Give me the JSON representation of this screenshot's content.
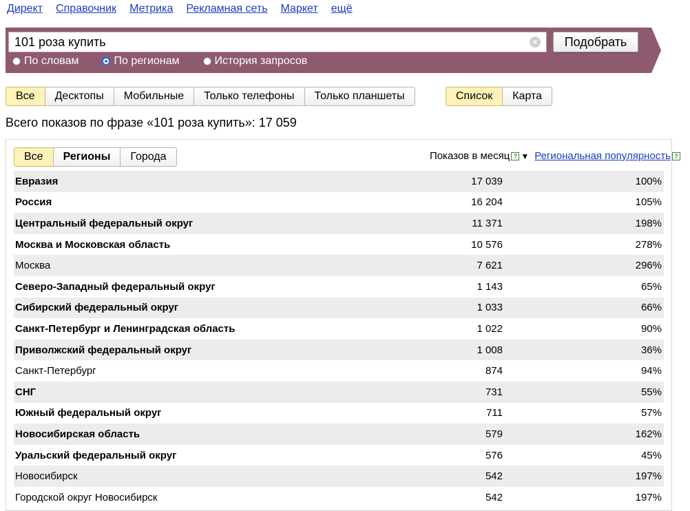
{
  "topnav": [
    "Директ",
    "Справочник",
    "Метрика",
    "Рекламная сеть",
    "Маркет",
    "ещё"
  ],
  "search": {
    "value": "101 роза купить",
    "button": "Подобрать"
  },
  "modes": [
    {
      "label": "По словам",
      "selected": false
    },
    {
      "label": "По регионам",
      "selected": true
    },
    {
      "label": "История запросов",
      "selected": false
    }
  ],
  "devices": [
    "Все",
    "Десктопы",
    "Мобильные",
    "Только телефоны",
    "Только планшеты"
  ],
  "devices_selected": 0,
  "views": [
    "Список",
    "Карта"
  ],
  "views_selected": 0,
  "summary": "Всего показов по фразе «101 роза купить»: 17 059",
  "region_tabs": [
    "Все",
    "Регионы",
    "Города"
  ],
  "region_tabs_selected": 0,
  "columns": {
    "shows": "Показов в месяц",
    "popularity": "Региональная популярность"
  },
  "rows": [
    {
      "name": "Евразия",
      "shows": "17 039",
      "pop": "100%",
      "bold": true
    },
    {
      "name": "Россия",
      "shows": "16 204",
      "pop": "105%",
      "bold": true
    },
    {
      "name": "Центральный федеральный округ",
      "shows": "11 371",
      "pop": "198%",
      "bold": true
    },
    {
      "name": "Москва и Московская область",
      "shows": "10 576",
      "pop": "278%",
      "bold": true
    },
    {
      "name": "Москва",
      "shows": "7 621",
      "pop": "296%",
      "bold": false
    },
    {
      "name": "Северо-Западный федеральный округ",
      "shows": "1 143",
      "pop": "65%",
      "bold": true
    },
    {
      "name": "Сибирский федеральный округ",
      "shows": "1 033",
      "pop": "66%",
      "bold": true
    },
    {
      "name": "Санкт-Петербург и Ленинградская область",
      "shows": "1 022",
      "pop": "90%",
      "bold": true
    },
    {
      "name": "Приволжский федеральный округ",
      "shows": "1 008",
      "pop": "36%",
      "bold": true
    },
    {
      "name": "Санкт-Петербург",
      "shows": "874",
      "pop": "94%",
      "bold": false
    },
    {
      "name": "СНГ",
      "shows": "731",
      "pop": "55%",
      "bold": true
    },
    {
      "name": "Южный федеральный округ",
      "shows": "711",
      "pop": "57%",
      "bold": true
    },
    {
      "name": "Новосибирская область",
      "shows": "579",
      "pop": "162%",
      "bold": true
    },
    {
      "name": "Уральский федеральный округ",
      "shows": "576",
      "pop": "45%",
      "bold": true
    },
    {
      "name": "Новосибирск",
      "shows": "542",
      "pop": "197%",
      "bold": false
    },
    {
      "name": "Городской округ Новосибирск",
      "shows": "542",
      "pop": "197%",
      "bold": false
    }
  ]
}
